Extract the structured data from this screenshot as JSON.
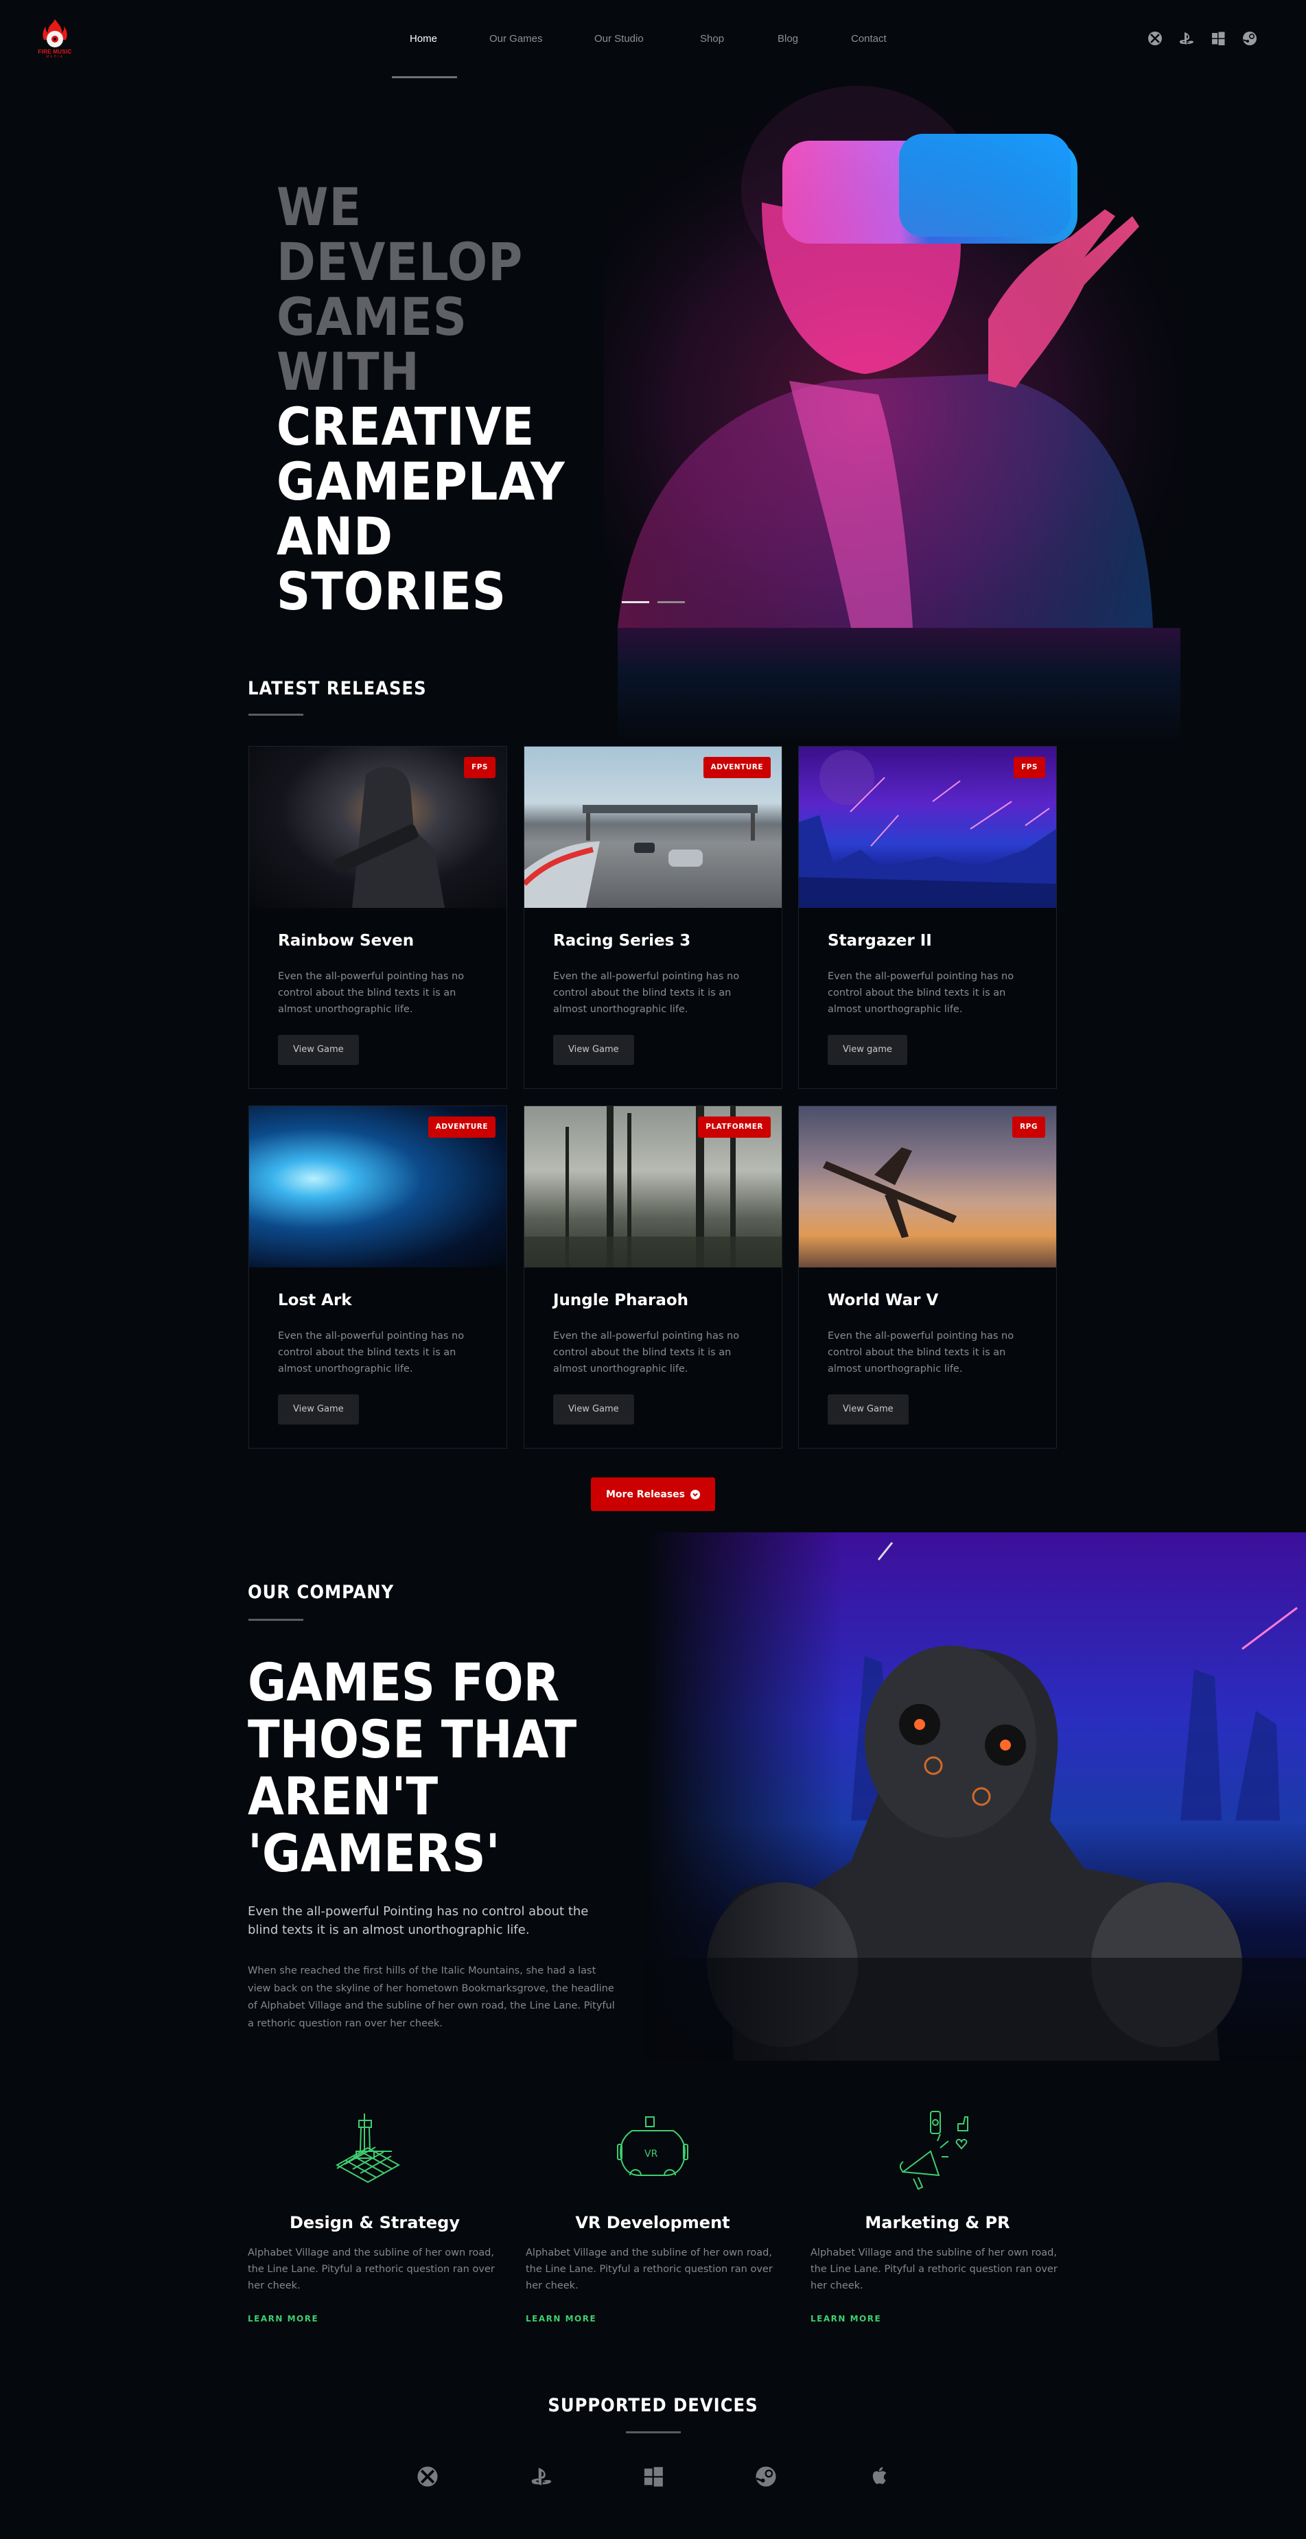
{
  "brand": {
    "name": "FIRE MUSIC",
    "subname": "MEDIA",
    "accent_color": "#cc0000",
    "link_color": "#3fce6f"
  },
  "nav": {
    "items": [
      {
        "label": "Home",
        "active": true
      },
      {
        "label": "Our Games",
        "active": false
      },
      {
        "label": "Our Studio",
        "active": false
      },
      {
        "label": "Shop",
        "active": false
      },
      {
        "label": "Blog",
        "active": false
      },
      {
        "label": "Contact",
        "active": false
      }
    ],
    "platform_icons": [
      "xbox-icon",
      "playstation-icon",
      "windows-icon",
      "steam-icon"
    ]
  },
  "hero": {
    "heading_dim": [
      "WE DEVELOP",
      "GAMES WITH"
    ],
    "heading_bright": [
      "CREATIVE",
      "GAMEPLAY",
      "AND",
      "STORIES"
    ],
    "slides": {
      "count": 2,
      "active": 1
    }
  },
  "latest_releases": {
    "title": "LATEST RELEASES",
    "cards": [
      {
        "title": "Rainbow Seven",
        "genre": "FPS",
        "description": "Even the all-powerful pointing has no control about the blind texts it is an almost unorthographic life.",
        "button": "View Game",
        "image": "soldier-image"
      },
      {
        "title": "Racing Series 3",
        "genre": "ADVENTURE",
        "description": "Even the all-powerful pointing has no control about the blind texts it is an almost unorthographic life.",
        "button": "View Game",
        "image": "racetrack-image"
      },
      {
        "title": "Stargazer II",
        "genre": "FPS",
        "description": "Even the all-powerful pointing has no control about the blind texts it is an almost unorthographic life.",
        "button": "View game",
        "image": "alien-landscape-image"
      },
      {
        "title": "Lost Ark",
        "genre": "ADVENTURE",
        "description": "Even the all-powerful pointing has no control about the blind texts it is an almost unorthographic life.",
        "button": "View Game",
        "image": "ice-cave-image"
      },
      {
        "title": "Jungle Pharaoh",
        "genre": "PLATFORMER",
        "description": "Even the all-powerful pointing has no control about the blind texts it is an almost unorthographic life.",
        "button": "View Game",
        "image": "forest-image"
      },
      {
        "title": "World War V",
        "genre": "RPG",
        "description": "Even the all-powerful pointing has no control about the blind texts it is an almost unorthographic life.",
        "button": "View Game",
        "image": "warplane-image"
      }
    ],
    "more_button": "More Releases"
  },
  "company": {
    "eyebrow": "OUR COMPANY",
    "heading": [
      "GAMES FOR",
      "THOSE THAT",
      "AREN'T",
      "'GAMERS'"
    ],
    "lead": "Even the all-powerful Pointing has no control about the blind texts it is an almost unorthographic life.",
    "body": "When she reached the first hills of the Italic Mountains, she had a last view back on the skyline of her hometown Bookmarksgrove, the headline of Alphabet Village and the subline of her own road, the Line Lane. Pityful a rethoric question ran over her cheek."
  },
  "services": [
    {
      "title": "Design & Strategy",
      "icon": "chess-rook-icon",
      "description": "Alphabet Village and the subline of her own road, the Line Lane. Pityful a rethoric question ran over her cheek.",
      "link": "LEARN MORE"
    },
    {
      "title": "VR Development",
      "icon": "vr-headset-icon",
      "description": "Alphabet Village and the subline of her own road, the Line Lane. Pityful a rethoric question ran over her cheek.",
      "link": "LEARN MORE",
      "icon_text": "VR"
    },
    {
      "title": "Marketing & PR",
      "icon": "megaphone-icon",
      "description": "Alphabet Village and the subline of her own road, the Line Lane. Pityful a rethoric question ran over her cheek.",
      "link": "LEARN MORE"
    }
  ],
  "supported_devices": {
    "title": "SUPPORTED DEVICES",
    "devices": [
      "xbox-icon",
      "playstation-icon",
      "windows-icon",
      "steam-icon",
      "apple-icon"
    ]
  }
}
